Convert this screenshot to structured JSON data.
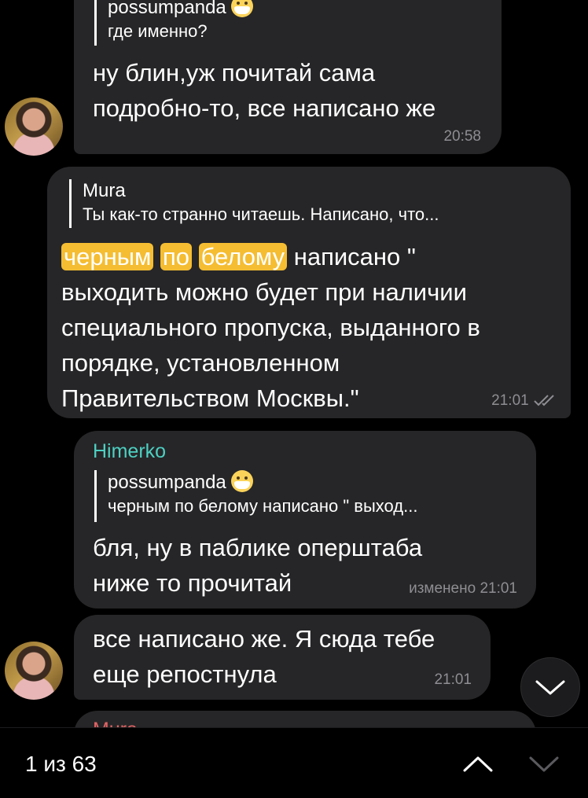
{
  "messages": [
    {
      "quote_author": "possumpanda",
      "quote_text": "где именно?",
      "text_lines": [
        "ну блин,уж почитай сама",
        "подробно-то, все написано же"
      ],
      "time": "20:58"
    },
    {
      "quote_author": "Mura",
      "quote_text": "Ты как-то странно читаешь. Написано, что...",
      "highlight_words": [
        "черным",
        "по",
        "белому"
      ],
      "line1_rest": " написано \"",
      "text_lines": [
        "выходить можно будет при наличии",
        "специального пропуска, выданного в",
        "порядке, установленном",
        "Правительством Москвы.\""
      ],
      "time": "21:01"
    },
    {
      "sender": "Himerko",
      "sender_color": "#4dd0c2",
      "quote_author": "possumpanda",
      "quote_text": "черным по белому написано \" выход...",
      "text_lines": [
        "бля, ну в паблике оперштаба",
        "ниже то прочитай"
      ],
      "edited_label": "изменено",
      "time": "21:01"
    },
    {
      "text_lines": [
        "все написано же. Я сюда тебе",
        "еще репостнула"
      ],
      "time": "21:01"
    },
    {
      "sender_partial": "Mura"
    }
  ],
  "search_nav": {
    "counter": "1 из 63",
    "up_icon": "chevron-up-icon",
    "down_icon": "chevron-down-icon"
  },
  "scroll_button_icon": "chevron-down-icon",
  "colors": {
    "highlight": "#f5bd32",
    "bubble": "#262628",
    "accent_sender": "#4dd0c2",
    "partial_sender": "#e06464"
  }
}
